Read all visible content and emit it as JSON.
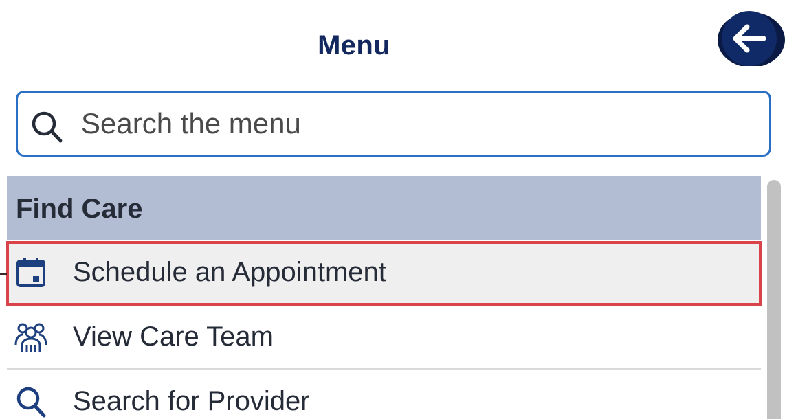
{
  "header": {
    "title": "Menu",
    "back_button_icon": "arrow-left-icon"
  },
  "search": {
    "placeholder": "Search the menu",
    "value": "",
    "icon": "search-icon"
  },
  "sections": [
    {
      "title": "Find Care",
      "items": [
        {
          "label": "Schedule an Appointment",
          "icon": "calendar-icon",
          "highlighted": true
        },
        {
          "label": "View Care Team",
          "icon": "care-team-icon",
          "highlighted": false
        },
        {
          "label": "Search for Provider",
          "icon": "search-icon",
          "highlighted": false
        }
      ]
    }
  ],
  "colors": {
    "title": "#12285f",
    "back_button": "#0f2a66",
    "search_border": "#2a6fc4",
    "section_header_bg": "#b2bdd4",
    "highlight_outline": "#d9434b",
    "icon_blue": "#1d3f7f"
  }
}
